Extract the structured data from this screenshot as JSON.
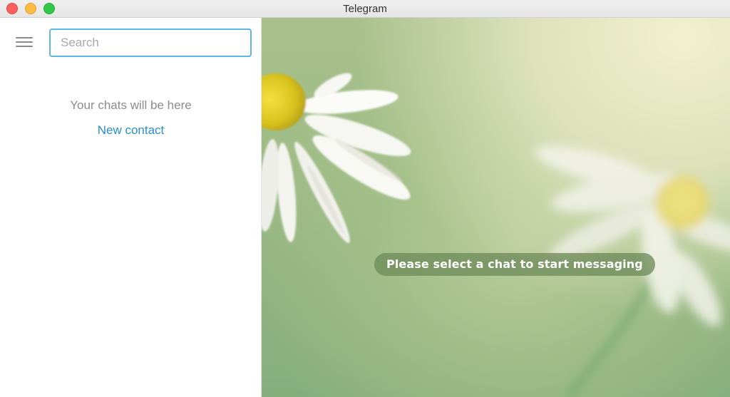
{
  "window": {
    "title": "Telegram",
    "controls": {
      "close_color": "#fc605c",
      "minimize_color": "#fdbc40",
      "zoom_color": "#34c84a"
    }
  },
  "sidebar": {
    "menu_icon": "hamburger-menu-icon",
    "search": {
      "placeholder": "Search",
      "value": ""
    },
    "empty_state": {
      "message": "Your chats will be here",
      "link_label": "New contact"
    }
  },
  "main": {
    "background": "daisy-flower-photo",
    "status_text": "Please select a chat to start messaging"
  },
  "colors": {
    "accent": "#2a8fc7",
    "search_border": "#5fb6e6",
    "pill_background": "#6e8c5a"
  }
}
